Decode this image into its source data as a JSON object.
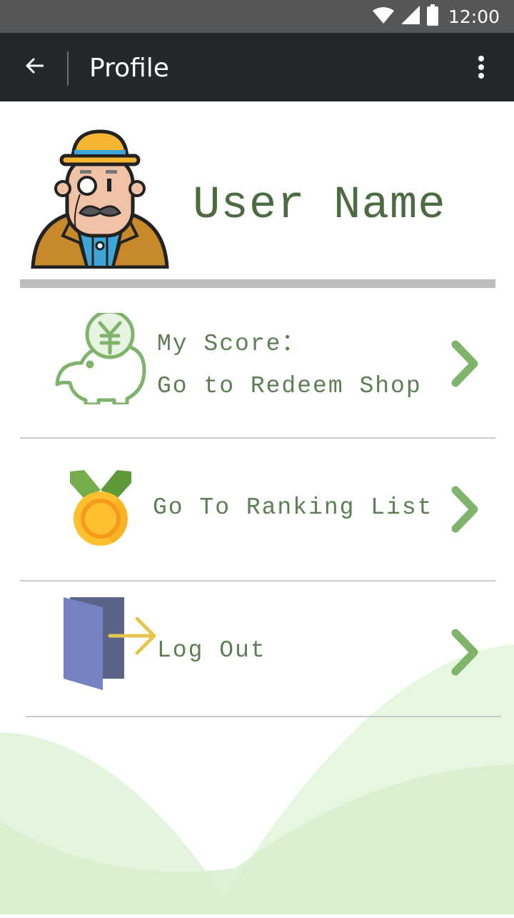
{
  "status_bar": {
    "time": "12:00",
    "icons": [
      "wifi-icon",
      "signal-icon",
      "battery-icon"
    ]
  },
  "app_bar": {
    "title": "Profile",
    "back_icon": "arrow-left-icon",
    "menu_icon": "more-vert-icon"
  },
  "profile": {
    "user_name": "User Name",
    "avatar_icon": "gentleman-avatar-icon"
  },
  "menu": {
    "score": {
      "label": "My Score：",
      "action": "Go to Redeem Shop",
      "icon": "piggy-bank-icon"
    },
    "ranking": {
      "label": "Go To Ranking List",
      "icon": "medal-icon"
    },
    "logout": {
      "label": "Log Out",
      "icon": "door-exit-icon"
    },
    "chevron_icon": "chevron-right-icon"
  },
  "colors": {
    "app_bar": "#22282b",
    "status_bar": "#555657",
    "text_green": "#5d7d55",
    "chevron_green": "#80b46c",
    "wave_green": "#cdedc2"
  }
}
